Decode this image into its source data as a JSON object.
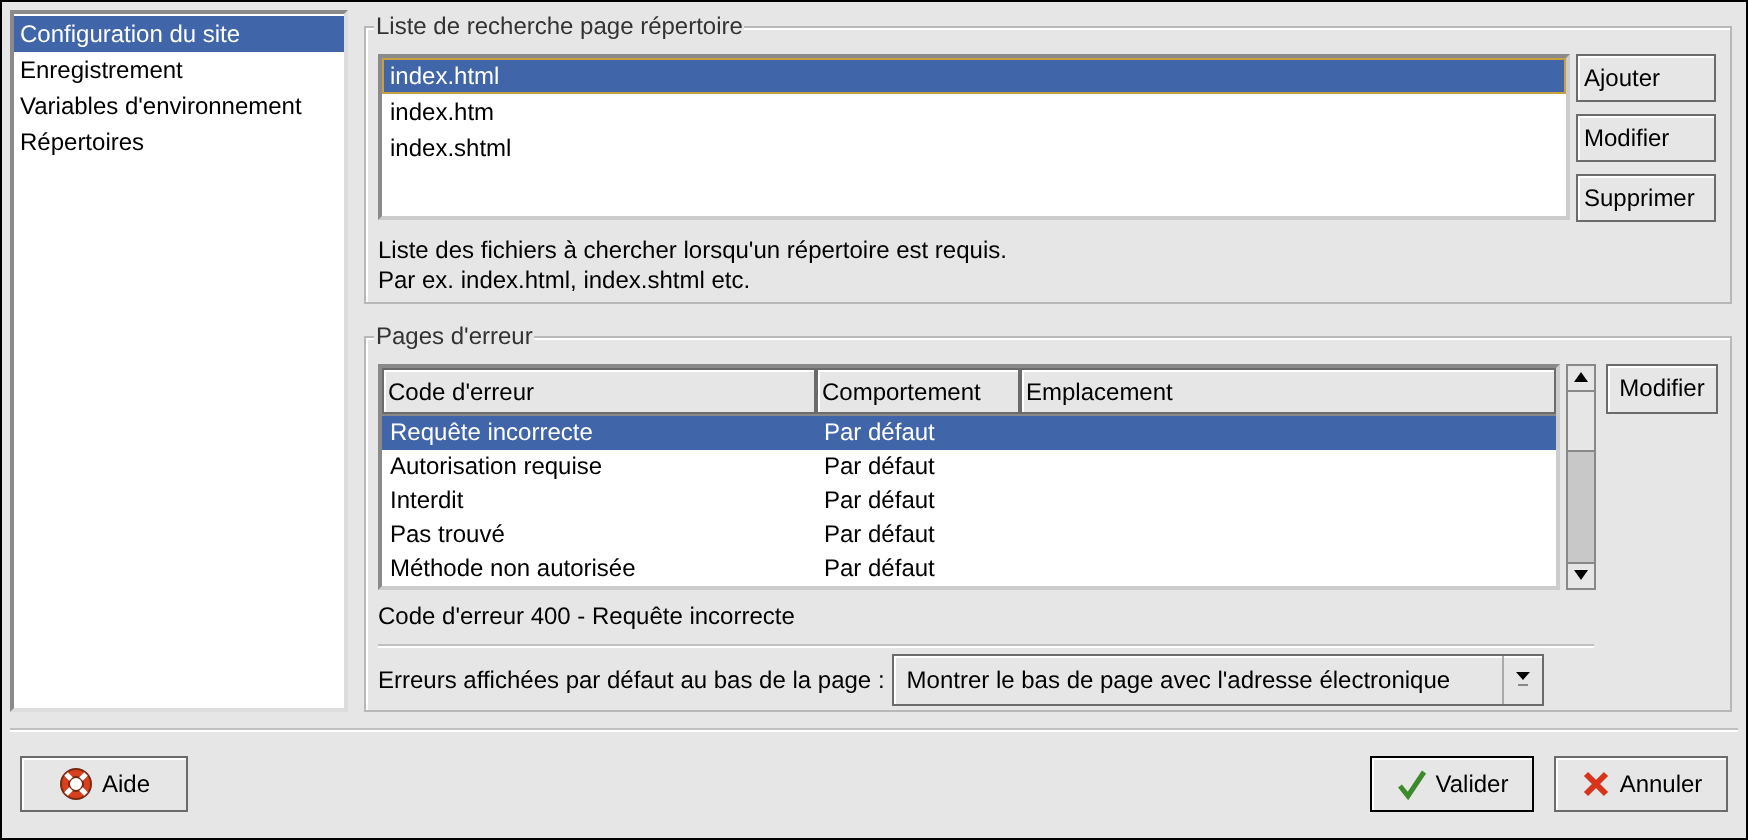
{
  "sidebar": {
    "items": [
      {
        "label": "Configuration du site",
        "selected": true
      },
      {
        "label": "Enregistrement",
        "selected": false
      },
      {
        "label": "Variables d'environnement",
        "selected": false
      },
      {
        "label": "Répertoires",
        "selected": false
      }
    ]
  },
  "directory_search": {
    "title": "Liste de recherche page répertoire",
    "items": [
      {
        "label": "index.html",
        "selected": true
      },
      {
        "label": "index.htm",
        "selected": false
      },
      {
        "label": "index.shtml",
        "selected": false
      }
    ],
    "buttons": [
      "Ajouter",
      "Modifier",
      "Supprimer"
    ],
    "description": [
      "Liste des fichiers à chercher lorsqu'un répertoire est requis.",
      "Par ex. index.html, index.shtml etc."
    ]
  },
  "error_pages": {
    "title": "Pages d'erreur",
    "columns": [
      "Code d'erreur",
      "Comportement",
      "Emplacement"
    ],
    "rows": [
      {
        "cells": [
          "Requête incorrecte",
          "Par défaut",
          ""
        ],
        "selected": true
      },
      {
        "cells": [
          "Autorisation requise",
          "Par défaut",
          ""
        ],
        "selected": false
      },
      {
        "cells": [
          "Interdit",
          "Par défaut",
          ""
        ],
        "selected": false
      },
      {
        "cells": [
          "Pas trouvé",
          "Par défaut",
          ""
        ],
        "selected": false
      },
      {
        "cells": [
          "Méthode non autorisée",
          "Par défaut",
          ""
        ],
        "selected": false
      }
    ],
    "button": "Modifier",
    "status": "Code d'erreur 400 - Requête incorrecte",
    "footer_label": "Erreurs affichées par défaut au bas de la page :",
    "footer_value": "Montrer le bas de page avec l'adresse électronique"
  },
  "buttons": [
    {
      "kind": "help",
      "label": "Aide"
    },
    {
      "kind": "ok",
      "label": "Valider"
    },
    {
      "kind": "cancel",
      "label": "Annuler"
    }
  ]
}
